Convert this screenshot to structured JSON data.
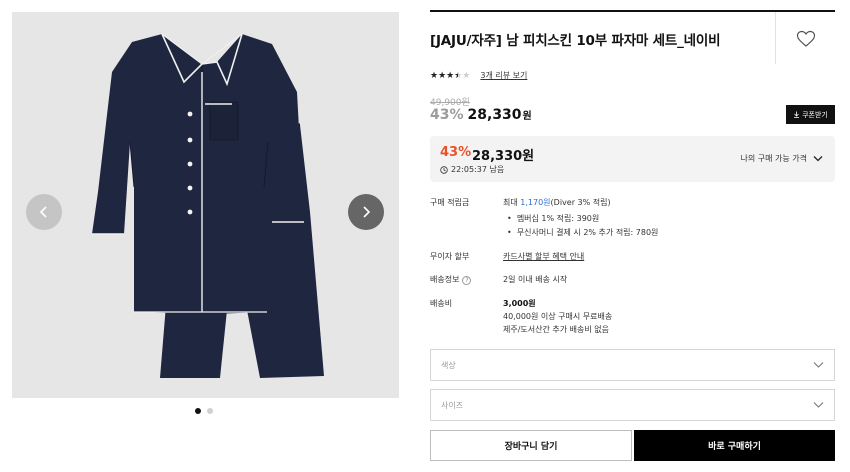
{
  "product": {
    "title": "[JAJU/자주] 남 피치스킨 10부 파자마 세트_네이비",
    "rating": {
      "stars": 3.5,
      "max": 5,
      "review_link": "3개 리뷰 보기"
    },
    "original_price": "49,900원",
    "discount_grey": "43%",
    "price": "28,330",
    "price_unit": "원",
    "coupon_button": "쿠폰받기"
  },
  "promo": {
    "discount": "43%",
    "price": "28,330원",
    "timer": "22:05:37 남음",
    "my_price_label": "나의 구매 가능 가격"
  },
  "info": {
    "points_label": "구매 적립금",
    "points_prefix": "최대 ",
    "points_amount": "1,170원",
    "points_suffix": "(Diver 3% 적립)",
    "points_bullets": [
      "멤버십 1% 적립: 390원",
      "무신사머니 결제 시 2% 추가 적립: 780원"
    ],
    "installment_label": "무이자 할부",
    "installment_link": "카드사별 할부 혜택 안내",
    "shipping_label": "배송정보",
    "shipping_value": "2일 이내 배송 시작",
    "fee_label": "배송비",
    "fee_amount": "3,000원",
    "fee_line1": "40,000원 이상 구매시 무료배송",
    "fee_line2": "제주/도서산간 추가 배송비 없음"
  },
  "options": {
    "color_placeholder": "색상",
    "size_placeholder": "사이즈"
  },
  "actions": {
    "cart": "장바구니 담기",
    "buy": "바로 구매하기"
  },
  "gallery": {
    "current": 1,
    "total": 2
  },
  "colors": {
    "accent": "#e8542a",
    "link_blue": "#2f6bd8",
    "navy": "#1f2640",
    "image_bg": "#e6e6e6"
  }
}
